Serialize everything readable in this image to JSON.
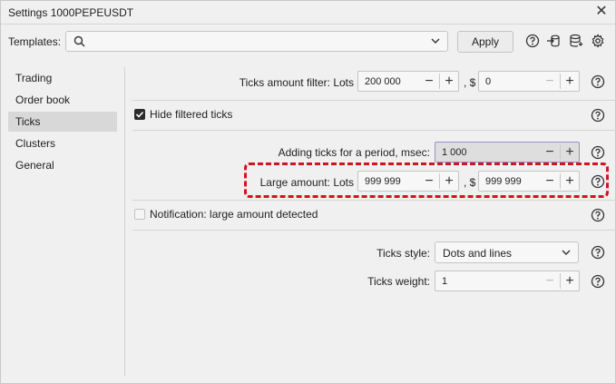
{
  "window": {
    "title": "Settings 1000PEPEUSDT"
  },
  "templates": {
    "label": "Templates:",
    "search_value": "",
    "apply_label": "Apply"
  },
  "sidebar": {
    "items": [
      {
        "label": "Trading",
        "active": false
      },
      {
        "label": "Order book",
        "active": false
      },
      {
        "label": "Ticks",
        "active": true
      },
      {
        "label": "Clusters",
        "active": false
      },
      {
        "label": "General",
        "active": false
      }
    ]
  },
  "ticks": {
    "amount_filter": {
      "label": "Ticks amount filter: Lots",
      "lots_value": "200 000",
      "dollar_label": ", $",
      "dollar_value": "0"
    },
    "hide_filtered": {
      "label": "Hide filtered ticks",
      "checked": true
    },
    "adding_period": {
      "label": "Adding ticks for a period, msec:",
      "value": "1 000"
    },
    "large_amount": {
      "label": "Large amount: Lots",
      "lots_value": "999 999",
      "dollar_label": ", $",
      "dollar_value": "999 999"
    },
    "notification": {
      "label": "Notification: large amount detected",
      "checked": false
    },
    "style": {
      "label": "Ticks style:",
      "value": "Dots and lines"
    },
    "weight": {
      "label": "Ticks weight:",
      "value": "1"
    }
  },
  "colors": {
    "highlight": "#d3141f",
    "active_item_bg": "#d8d8d8",
    "focused_field_border": "#9a8fd1"
  }
}
